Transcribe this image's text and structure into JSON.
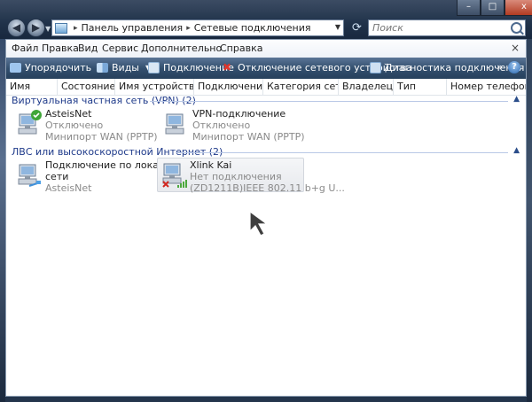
{
  "window": {
    "controls": {
      "minimize": "–",
      "maximize": "□",
      "close": "x"
    }
  },
  "address": {
    "back_icon": "back-arrow-icon",
    "forward_icon": "forward-arrow-icon",
    "crumbs": [
      "Панель управления",
      "Сетевые подключения"
    ],
    "refresh_icon": "refresh-icon"
  },
  "search": {
    "placeholder": "Поиск"
  },
  "menu": [
    "Файл",
    "Правка",
    "Вид",
    "Сервис",
    "Дополнительно",
    "Справка"
  ],
  "toolbar": {
    "organize": "Упорядочить",
    "views": "Виды",
    "connect": "Подключение",
    "disable": "Отключение сетевого устройства",
    "diagnose": "Диагностика подключения",
    "more": "»",
    "help": "?"
  },
  "columns": [
    "Имя",
    "Состояние",
    "Имя устройства",
    "Подключение",
    "Категория сети",
    "Владелец",
    "Тип",
    "Номер телефона..."
  ],
  "groups": [
    {
      "title": "Виртуальная частная сеть (VPN) (2)",
      "items": [
        {
          "name": "AsteisNet",
          "status": "Отключено",
          "device": "Минипорт WAN (PPTP)",
          "icon": "vpn-connected-icon"
        },
        {
          "name": "VPN-подключение",
          "status": "Отключено",
          "device": "Минипорт WAN (PPTP)",
          "icon": "vpn-icon"
        }
      ]
    },
    {
      "title": "ЛВС или высокоскоростной Интернет (2)",
      "items": [
        {
          "name": "Подключение по локальной",
          "name2": "сети",
          "status": "AsteisNet",
          "icon": "lan-icon"
        },
        {
          "name": "Xlink Kai",
          "status": "Нет подключения",
          "device": "(ZD1211B)IEEE 802.11 b+g U...",
          "icon": "wireless-disconnected-icon"
        }
      ]
    }
  ],
  "colors": {
    "group_title": "#1e3a8a",
    "toolbar": "#34506f",
    "sub_text": "#8a8a8a"
  }
}
